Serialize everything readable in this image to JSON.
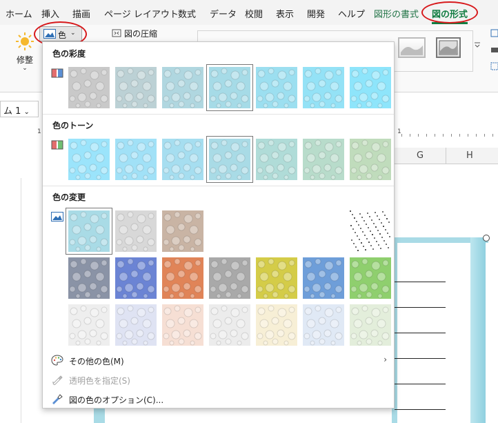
{
  "ribbon_tabs": [
    {
      "label": "ホーム",
      "state": "normal"
    },
    {
      "label": "挿入",
      "state": "normal"
    },
    {
      "label": "描画",
      "state": "normal"
    },
    {
      "label": "ページ レイアウト",
      "state": "normal"
    },
    {
      "label": "数式",
      "state": "normal"
    },
    {
      "label": "データ",
      "state": "normal"
    },
    {
      "label": "校閲",
      "state": "normal"
    },
    {
      "label": "表示",
      "state": "normal"
    },
    {
      "label": "開発",
      "state": "normal"
    },
    {
      "label": "ヘルプ",
      "state": "normal"
    },
    {
      "label": "図形の書式",
      "state": "contextual"
    },
    {
      "label": "図の形式",
      "state": "active"
    }
  ],
  "ribbon": {
    "adjust_label": "修整",
    "color_button_label": "色",
    "compress_label": "図の圧縮"
  },
  "formula_bar": {
    "name_box": "ム 1"
  },
  "ruler": {
    "numbers": [
      "1",
      "1"
    ]
  },
  "column_headers": [
    "G",
    "H"
  ],
  "color_menu": {
    "saturation": {
      "title": "色の彩度",
      "swatches": [
        {
          "tint": "#c9c9c9"
        },
        {
          "tint": "#bcd1d5"
        },
        {
          "tint": "#b0d7e0"
        },
        {
          "tint": "#a6dbe7",
          "selected": true
        },
        {
          "tint": "#9cdff0"
        },
        {
          "tint": "#94e2f6"
        },
        {
          "tint": "#8ee5fb"
        }
      ]
    },
    "tone": {
      "title": "色のトーン",
      "swatches": [
        {
          "tint": "#9be4fb"
        },
        {
          "tint": "#a1e1f7"
        },
        {
          "tint": "#a6def0"
        },
        {
          "tint": "#a9dbe6",
          "selected": true
        },
        {
          "tint": "#b0dcd8"
        },
        {
          "tint": "#b8dccb"
        },
        {
          "tint": "#c0dcbc"
        }
      ]
    },
    "recolor": {
      "title": "色の変更",
      "rows": [
        [
          {
            "tint": "#a9dbe6",
            "selected": true
          },
          {
            "tint": "#d8d8d8"
          },
          {
            "tint": "#c9b4a4"
          },
          {
            "tint": "#ffffff",
            "blank": true
          },
          {
            "tint": "#ffffff",
            "blank": true
          },
          {
            "tint": "#ffffff",
            "blank": true
          },
          {
            "tint": "#ffffff",
            "speckle": true
          }
        ],
        [
          {
            "tint": "#8a93a6"
          },
          {
            "tint": "#6b84d4"
          },
          {
            "tint": "#e08458"
          },
          {
            "tint": "#a9a9a9"
          },
          {
            "tint": "#d4cc48"
          },
          {
            "tint": "#6e9ed9"
          },
          {
            "tint": "#8fcf6e"
          }
        ],
        [
          {
            "tint": "#eeeeee"
          },
          {
            "tint": "#dfe3f3"
          },
          {
            "tint": "#f6dfd4"
          },
          {
            "tint": "#ececec"
          },
          {
            "tint": "#f7efd6"
          },
          {
            "tint": "#e0e9f5"
          },
          {
            "tint": "#e3eedb"
          }
        ]
      ]
    },
    "more_colors": {
      "label": "その他の色(M)"
    },
    "transparent": {
      "label": "透明色を指定(S)"
    },
    "options": {
      "label": "図の色のオプション(C)..."
    }
  },
  "colors": {
    "highlight_ring": "#d7191c",
    "accent_green": "#107c41",
    "contextual_green": "#217346"
  }
}
